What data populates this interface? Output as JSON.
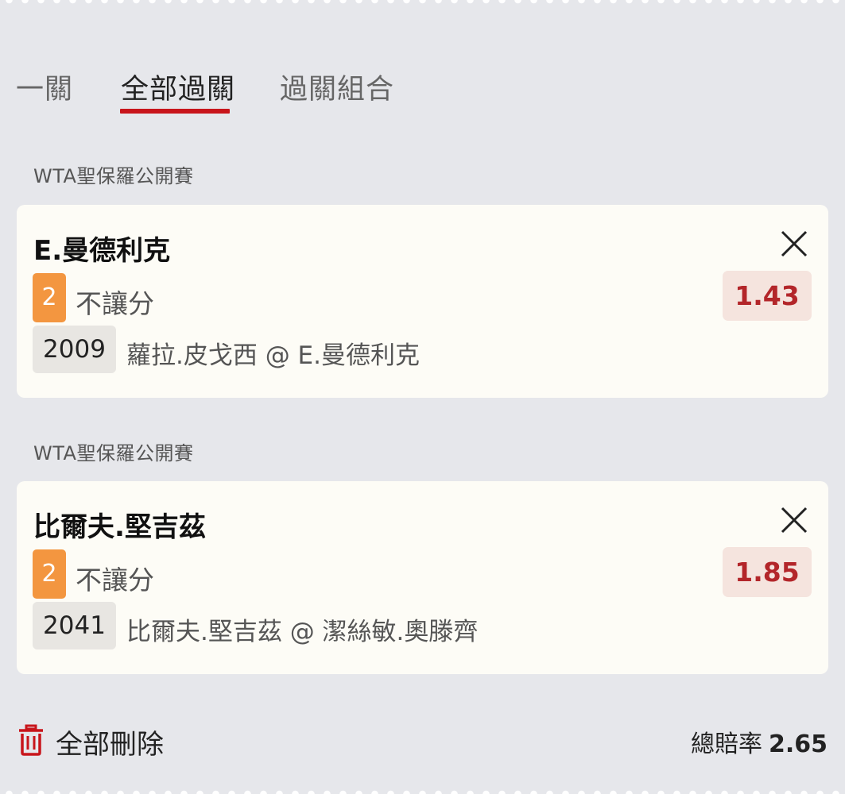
{
  "tabs": [
    {
      "label": "一關"
    },
    {
      "label": "全部過關"
    },
    {
      "label": "過關組合"
    }
  ],
  "active_tab_index": 1,
  "accent_color": "#c8151b",
  "selections": [
    {
      "league": "WTA聖保羅公開賽",
      "title": "E.曼德利克",
      "line_badge": "2",
      "bet_type": "不讓分",
      "odds": "1.43",
      "match_no": "2009",
      "match_desc": "蘿拉.皮戈西 @ E.曼德利克"
    },
    {
      "league": "WTA聖保羅公開賽",
      "title": "比爾夫.堅吉茲",
      "line_badge": "2",
      "bet_type": "不讓分",
      "odds": "1.85",
      "match_no": "2041",
      "match_desc": "比爾夫.堅吉茲 @ 潔絲敏.奧滕齊"
    }
  ],
  "footer": {
    "delete_all_label": "全部刪除",
    "total_odds_label": "總賠率",
    "total_odds_value": "2.65"
  },
  "icons": {
    "close": "close-icon",
    "trash": "trash-icon"
  }
}
